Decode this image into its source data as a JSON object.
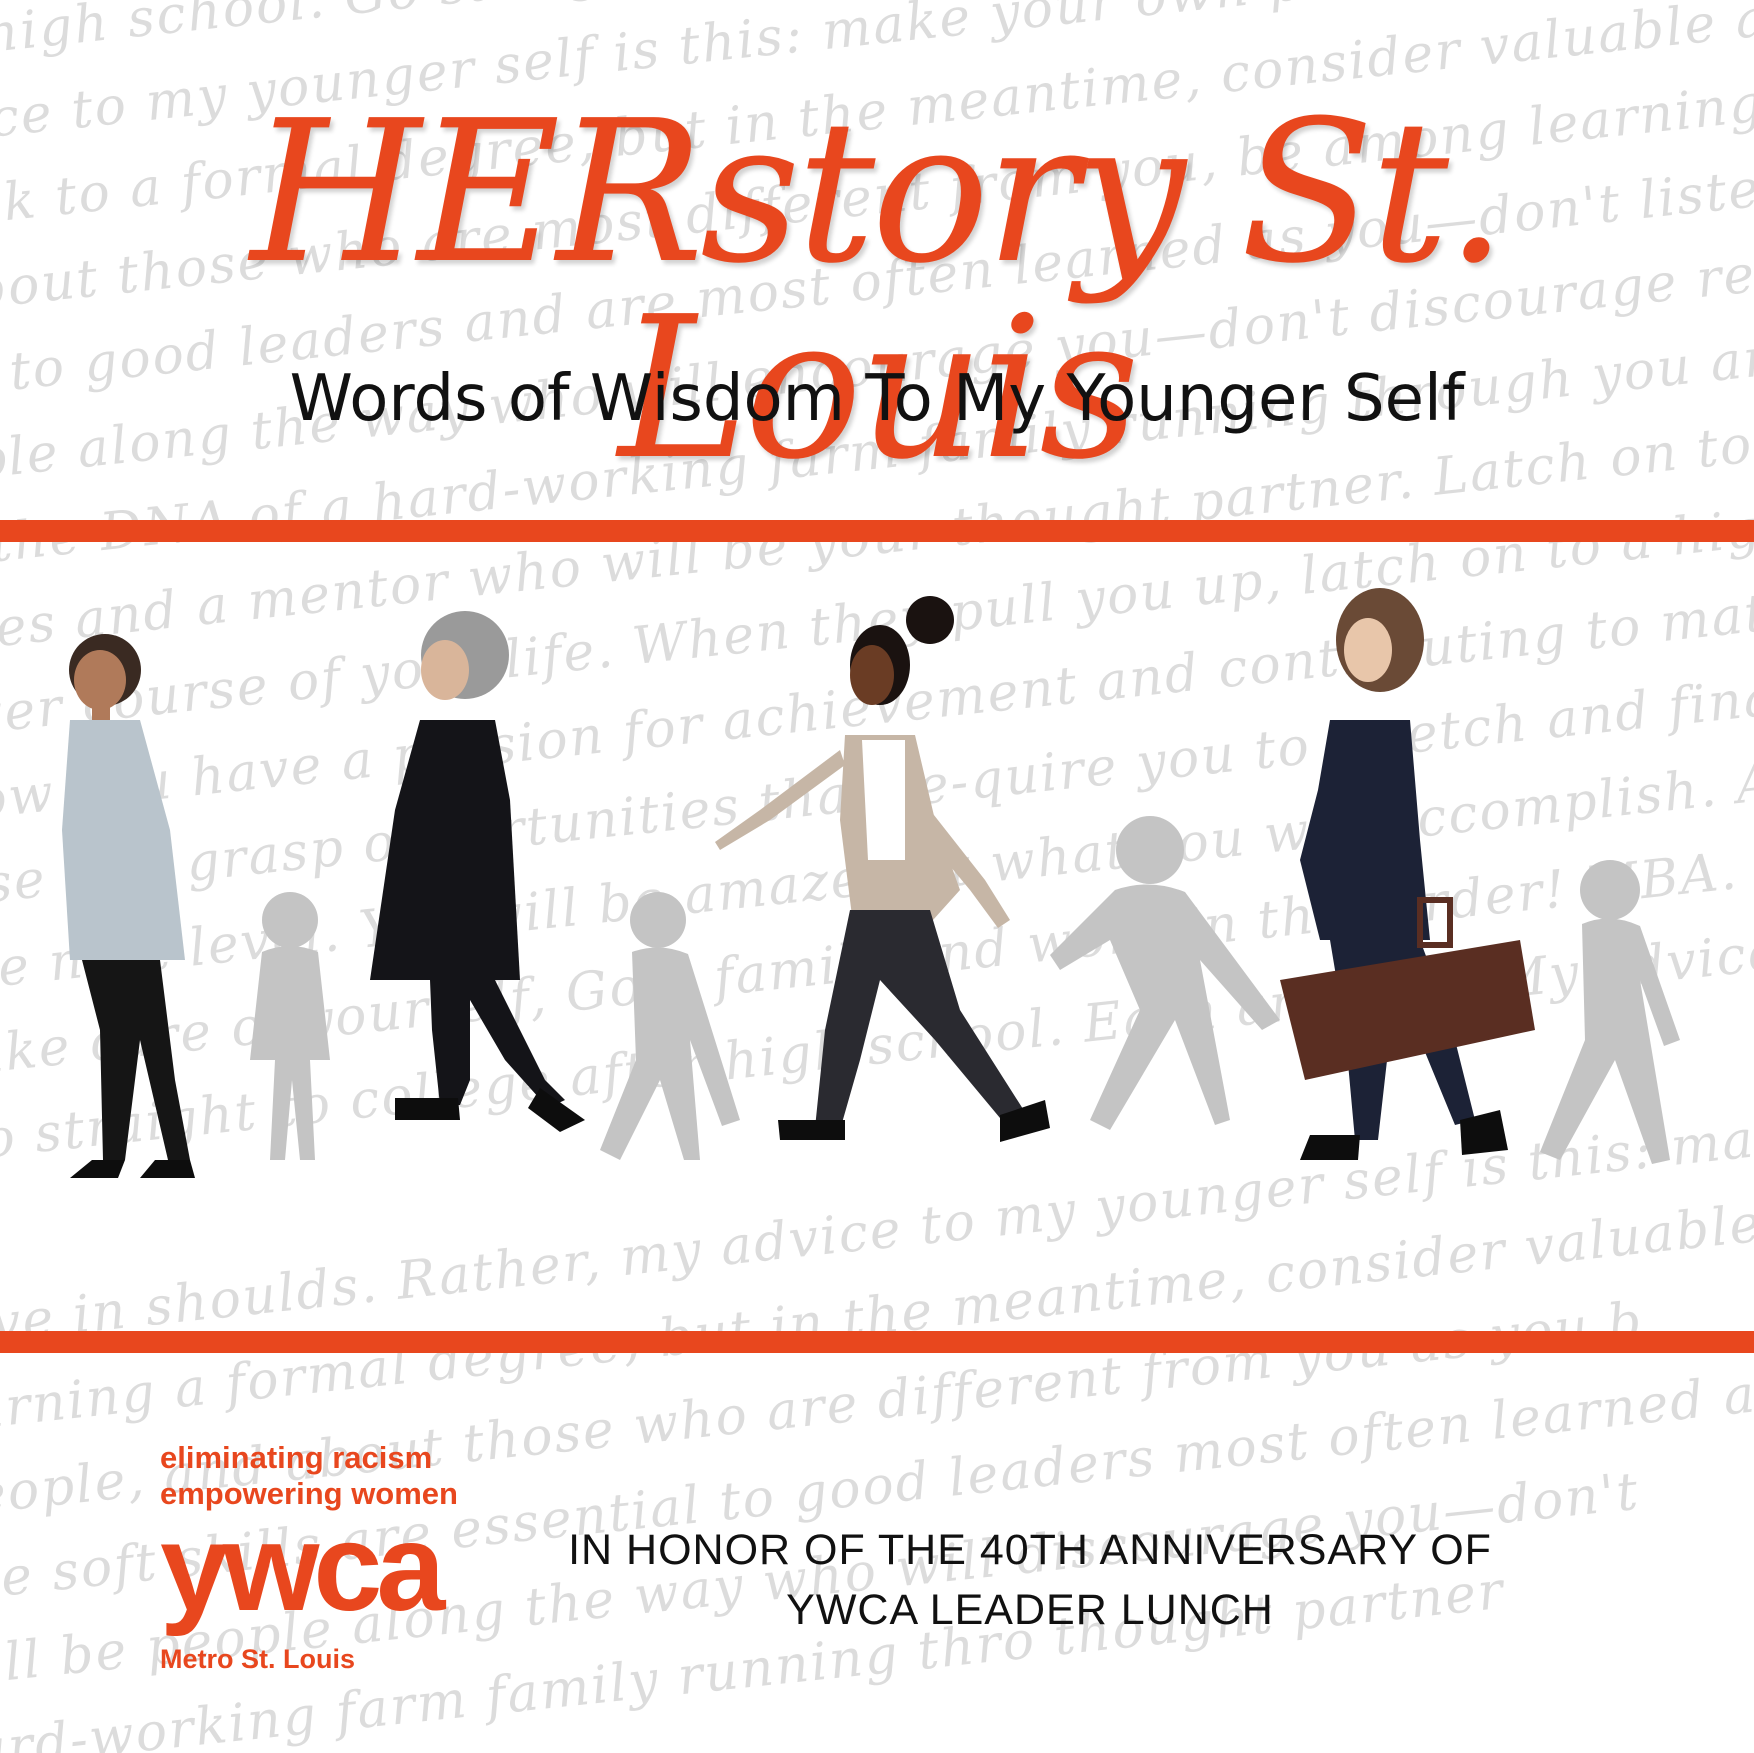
{
  "background_script_lines": [
    "r high school. Go straight to college after high school make you... consider everything",
    "vice to my younger self is this: make your own path in the meantime, consider education. The",
    "ack to a formal degree, but in the meantime, consider valuable aspects of your unique path",
    "about those who are most different from you, be among learning from them. You are",
    "al to good leaders and are most often learned as you—don't listen to them. Listen in",
    "ople along the way who will encourage you—don't discourage reins. Listen in",
    "e the DNA of a hard-working farm family running through you are lucky, you will",
    "ates and a mentor who will be your thought partner. Latch on to all of them. Move to",
    "over course of your life. When they pull you up, latch on to a higher level. H",
    "now you have a passion for achievement and contributing to match your abilities",
    "rise and grasp opportunities that re-quire you to stretch and finally, don't",
    "the next level. You will be amazed at what you will accomplish. Always take ca",
    "Take care of yourself, God, family and work in that order! MBA. Make your own path",
    "Go straight to college after high school. Earn an MBA. My advice to my younger self is this",
    "ieve in shoulds. Rather, my advice to my younger self is this: make your own path",
    "earning a formal degree, but in the meantime, consider valuable aspects",
    "people, and about those who are different from you as you b",
    "ese soft skills are essential to good leaders most often learned as you—don't",
    "will be people along the way who will discourage you—don't",
    "hard-working farm family running thro thought partner"
  ],
  "title": "HERstory St. Louis",
  "subtitle": "Words of Wisdom To My Younger Self",
  "logo": {
    "tagline_1": "eliminating racism",
    "tagline_2": "empowering women",
    "wordmark": "ywca",
    "location": "Metro St. Louis"
  },
  "honor_line_1": "IN HONOR OF THE 40TH ANNIVERSARY OF",
  "honor_line_2": "YWCA LEADER LUNCH",
  "colors": {
    "accent": "#e8471e",
    "text": "#111111",
    "script": "#dcdcdc",
    "silhouette": "#c4c4c4"
  }
}
